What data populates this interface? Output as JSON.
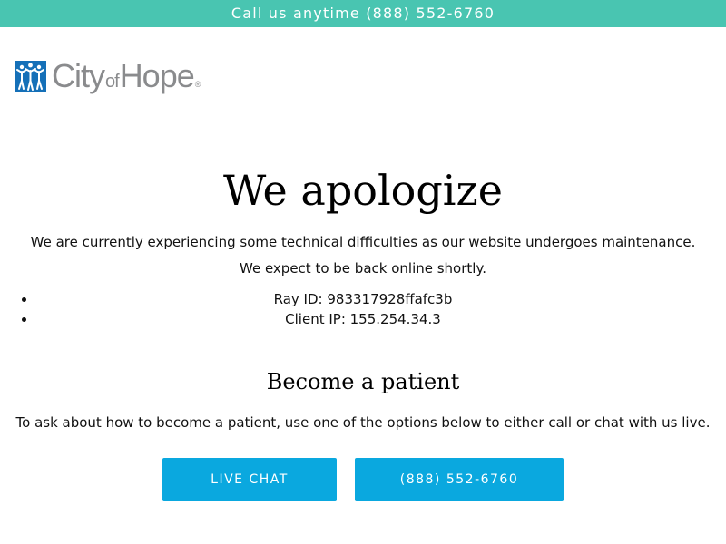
{
  "topbar": {
    "text": "Call us anytime (888) 552-6760"
  },
  "brand": {
    "name_part1": "City",
    "name_part2": "of",
    "name_part3": "Hope",
    "registered": "®",
    "logo_icon": "city-of-hope-figures-icon",
    "logo_color": "#1570b8"
  },
  "main": {
    "title": "We apologize",
    "message_line1": "We are currently experiencing some technical difficulties as our website undergoes maintenance.",
    "message_line2": "We expect to be back online shortly.",
    "info": [
      "Ray ID: 983317928ffafc3b",
      "Client IP: 155.254.34.3"
    ]
  },
  "patient": {
    "heading": "Become a patient",
    "description": "To ask about how to become a patient, use one of the options below to either call or chat with us live.",
    "buttons": {
      "chat_label": "LIVE CHAT",
      "phone_label": "(888) 552-6760"
    }
  },
  "colors": {
    "topbar": "#49c5b1",
    "button": "#0aa8df",
    "logo_text": "#8a8b8d"
  }
}
